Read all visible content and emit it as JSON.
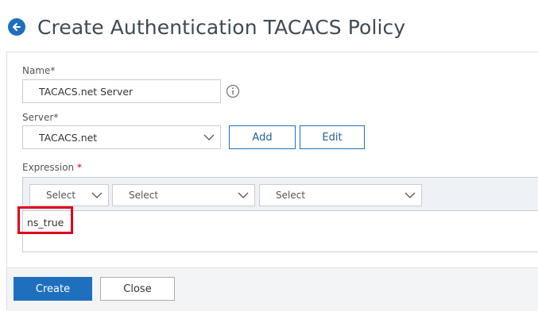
{
  "header": {
    "back_icon": "arrow-left-icon",
    "title": "Create Authentication TACACS Policy"
  },
  "form": {
    "name": {
      "label": "Name",
      "required_mark": "*",
      "value": "TACACS.net Server",
      "info_icon": "info-icon"
    },
    "server": {
      "label": "Server",
      "required_mark": "*",
      "selected": "TACACS.net",
      "add_label": "Add",
      "edit_label": "Edit"
    },
    "expression": {
      "label": "Expression",
      "required_mark": "*",
      "selects": [
        "Select",
        "Select",
        "Select"
      ],
      "value": "ns_true"
    }
  },
  "footer": {
    "create_label": "Create",
    "close_label": "Close"
  },
  "colors": {
    "accent": "#1f6fbf",
    "highlight": "#e0001b",
    "required": "#d0021b"
  }
}
